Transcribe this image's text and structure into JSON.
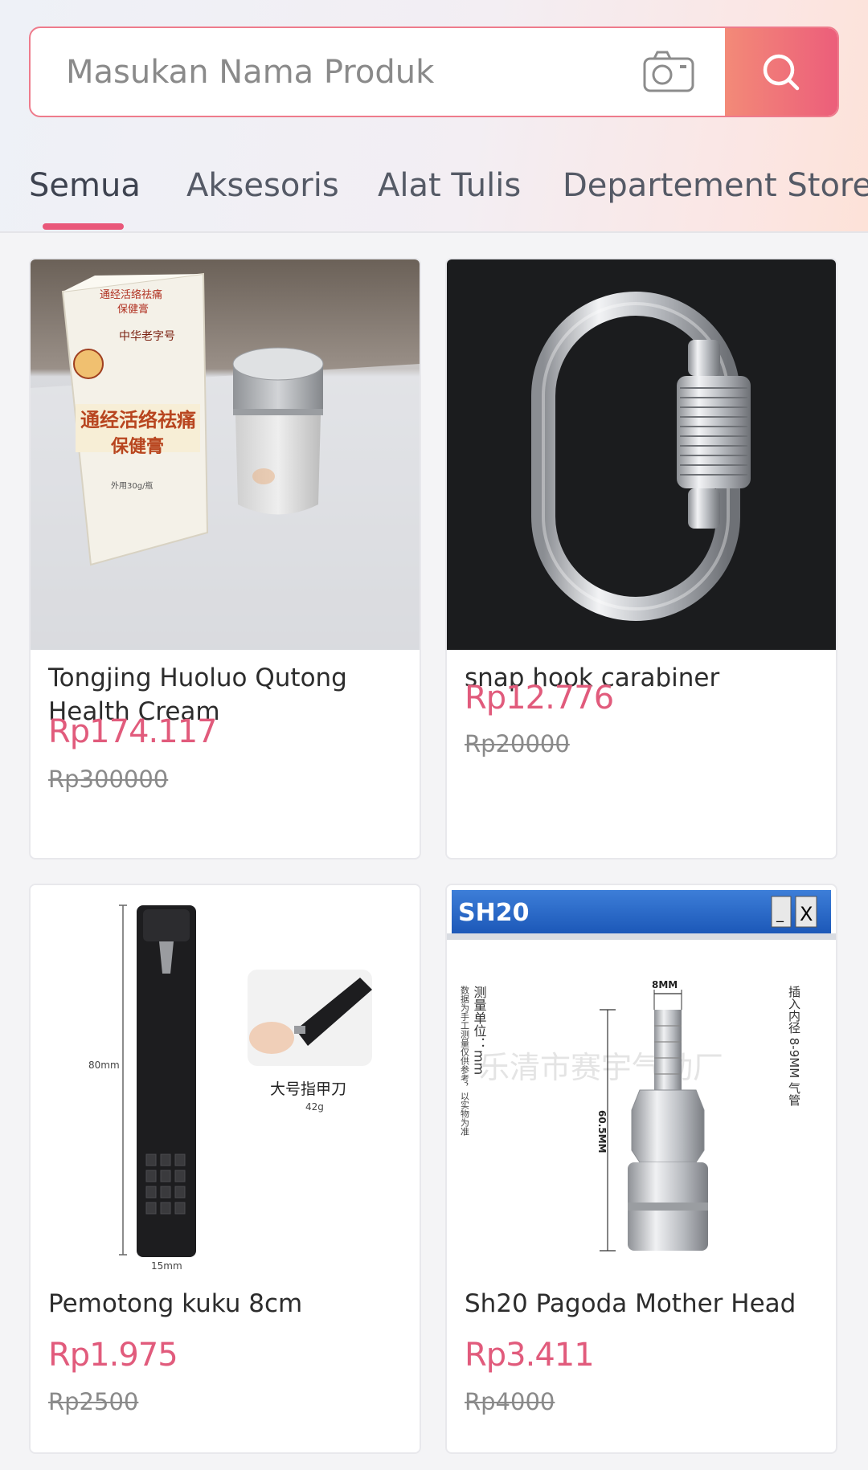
{
  "search": {
    "placeholder": "Masukan Nama Produk"
  },
  "icons": {
    "camera": "camera-icon",
    "search": "search-icon"
  },
  "tabs": [
    {
      "label": "Semua",
      "active": true
    },
    {
      "label": "Aksesoris",
      "active": false
    },
    {
      "label": "Alat Tulis",
      "active": false
    },
    {
      "label": "Departement Store",
      "active": false
    }
  ],
  "colors": {
    "accent": "#e9577a",
    "price": "#e15b7c",
    "search_button_start": "#f38a78",
    "search_button_end": "#ec5e7a"
  },
  "products": [
    {
      "name": "Tongjing Huoluo Qutong Health Cream",
      "price": "Rp174.117",
      "old_price": "Rp300000",
      "image_text": {
        "box_title": "通经活络祛痛",
        "box_subtitle": "保健膏",
        "brand": "中华老字号",
        "weight": "外用30g/瓶"
      }
    },
    {
      "name": "snap hook carabiner",
      "price": "Rp12.776",
      "old_price": "Rp20000"
    },
    {
      "name": "Pemotong kuku 8cm",
      "price": "Rp1.975",
      "old_price": "Rp2500",
      "image_text": {
        "height": "80mm",
        "width": "15mm",
        "label": "大号指甲刀",
        "weight": "42g"
      }
    },
    {
      "name": "Sh20 Pagoda Mother Head",
      "price": "Rp3.411",
      "old_price": "Rp4000",
      "image_text": {
        "window_title": "SH20",
        "minimize": "_",
        "close": "X",
        "top_dim": "8MM",
        "side_dim": "60.5MM",
        "left_note_1": "测量单位：mm",
        "left_note_2": "数据为手工测量仅供参考，以实物为准",
        "right_note": "插入内径 8-9MM 气管",
        "watermark": "乐清市赛宇气动厂"
      }
    }
  ]
}
